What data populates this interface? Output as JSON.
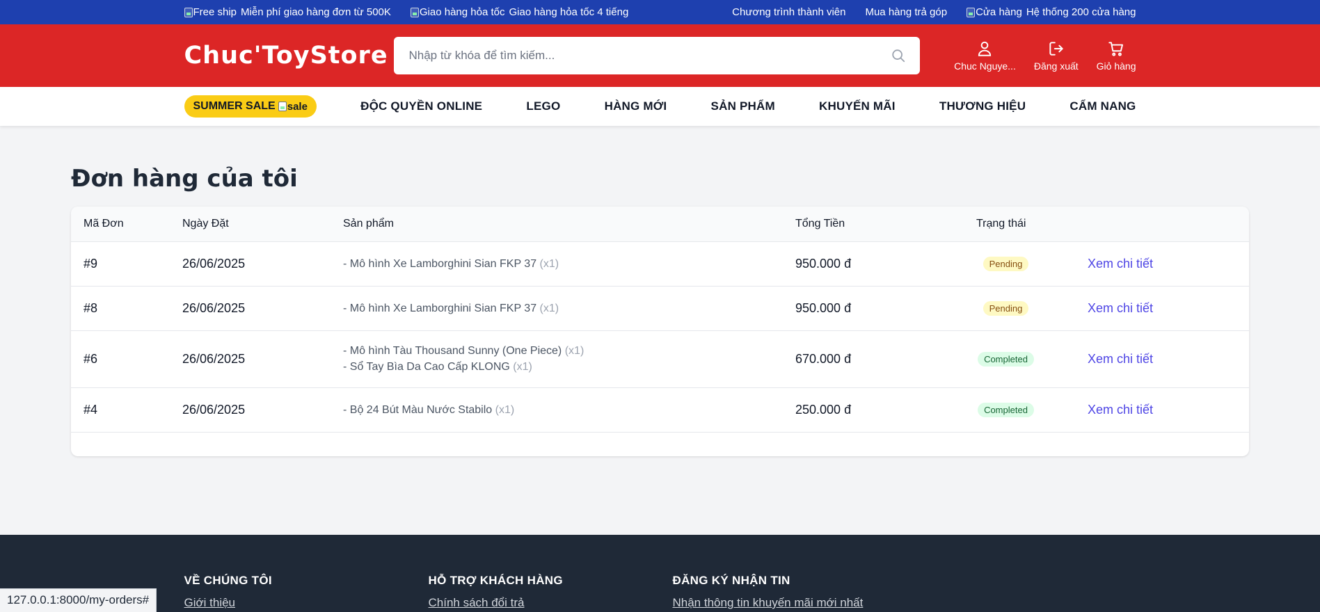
{
  "topbar": {
    "freeship_alt": "Free ship",
    "freeship_text": "Miễn phí giao hàng đơn từ 500K",
    "express_alt": "Giao hàng hỏa tốc",
    "express_text": "Giao hàng hỏa tốc 4 tiếng",
    "membership": "Chương trình thành viên",
    "installment": "Mua hàng trả góp",
    "store_alt": "Cửa hàng",
    "store_text": "Hệ thống 200 cửa hàng"
  },
  "header": {
    "logo": "Chuc'ToyStore",
    "search_placeholder": "Nhập từ khóa để tìm kiếm...",
    "user_label": "Chuc Nguye...",
    "logout_label": "Đăng xuất",
    "cart_label": "Giỏ hàng"
  },
  "nav": {
    "sale_label": "SUMMER SALE",
    "sale_img_alt": "sale",
    "items": [
      "ĐỘC QUYỀN ONLINE",
      "LEGO",
      "HÀNG MỚI",
      "SẢN PHẨM",
      "KHUYẾN MÃI",
      "THƯƠNG HIỆU",
      "CẨM NANG"
    ]
  },
  "page": {
    "title": "Đơn hàng của tôi"
  },
  "orders_table": {
    "headers": [
      "Mã Đơn",
      "Ngày Đặt",
      "Sản phẩm",
      "Tổng Tiền",
      "Trạng thái"
    ],
    "detail_label": "Xem chi tiết",
    "rows": [
      {
        "id": "#9",
        "date": "26/06/2025",
        "products": [
          {
            "name": "- Mô hình Xe Lamborghini Sian FKP 37",
            "qty": "(x1)"
          }
        ],
        "total": "950.000 đ",
        "status": "Pending"
      },
      {
        "id": "#8",
        "date": "26/06/2025",
        "products": [
          {
            "name": "- Mô hình Xe Lamborghini Sian FKP 37",
            "qty": "(x1)"
          }
        ],
        "total": "950.000 đ",
        "status": "Pending"
      },
      {
        "id": "#6",
        "date": "26/06/2025",
        "products": [
          {
            "name": "- Mô hình Tàu Thousand Sunny (One Piece)",
            "qty": "(x1)"
          },
          {
            "name": "- Sổ Tay Bìa Da Cao Cấp KLONG",
            "qty": "(x1)"
          }
        ],
        "total": "670.000 đ",
        "status": "Completed"
      },
      {
        "id": "#4",
        "date": "26/06/2025",
        "products": [
          {
            "name": "- Bộ 24 Bút Màu Nước Stabilo",
            "qty": "(x1)"
          }
        ],
        "total": "250.000 đ",
        "status": "Completed"
      }
    ]
  },
  "footer": {
    "col1_title": "VỀ CHÚNG TÔI",
    "col1_link": "Giới thiệu",
    "col2_title": "HỖ TRỢ KHÁCH HÀNG",
    "col2_link": "Chính sách đổi trả",
    "col3_title": "ĐĂNG KÝ NHẬN TIN",
    "col3_text": "Nhận thông tin khuyến mãi mới nhất"
  },
  "statusbar": {
    "url": "127.0.0.1:8000/my-orders#"
  },
  "colors": {
    "topbar": "#1e40af",
    "header": "#dc2626",
    "sale_pill": "#facc15",
    "link": "#4f46e5",
    "footer": "#1f2937"
  }
}
